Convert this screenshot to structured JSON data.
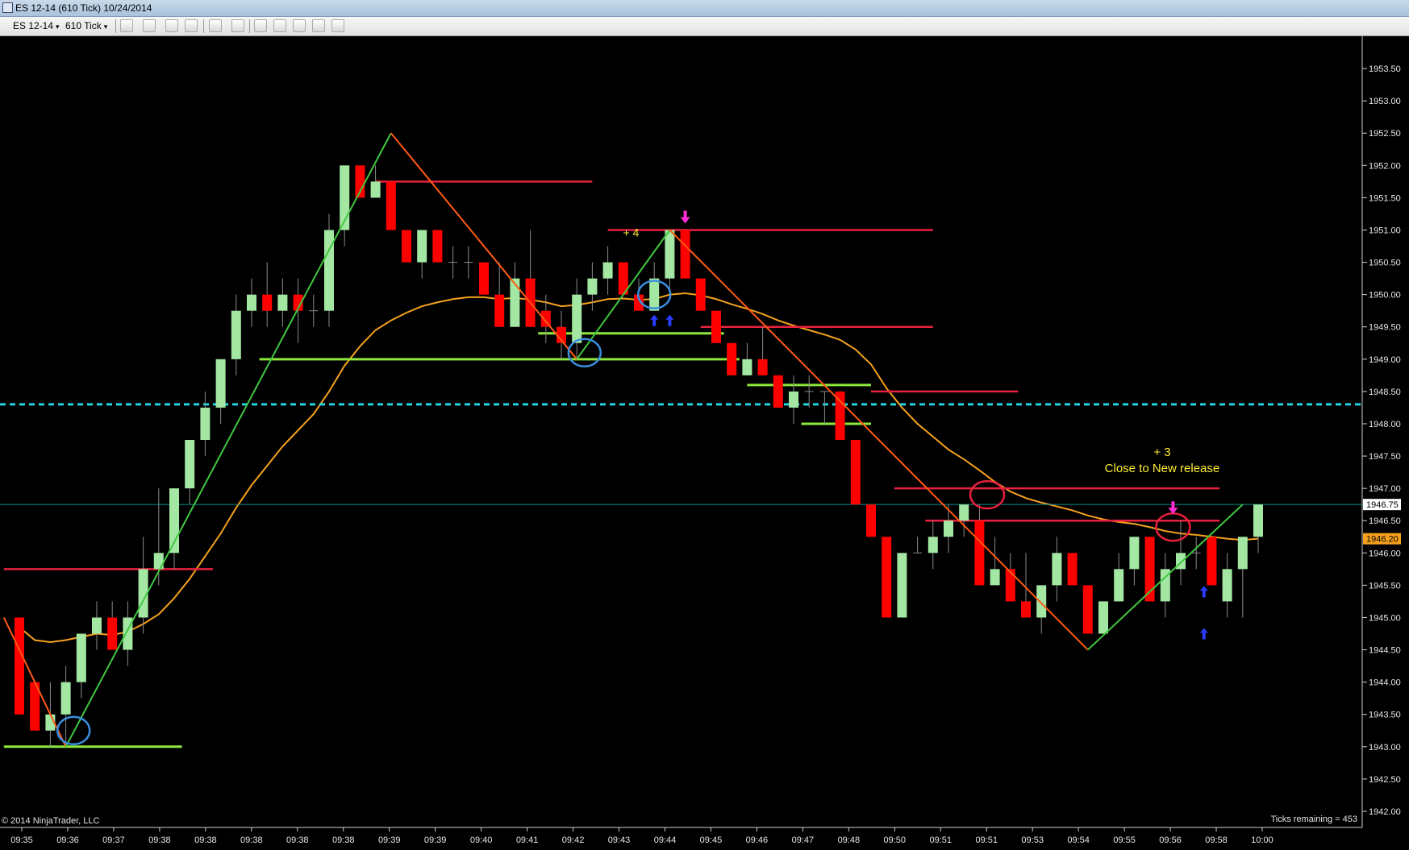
{
  "window": {
    "title": "ES 12-14 (610 Tick)  10/24/2014"
  },
  "toolbar": {
    "instrument": "ES 12-14",
    "interval": "610 Tick",
    "icons": [
      "bar-type-icon",
      "pencil-draw-icon",
      "indicator-icon",
      "strategy-icon",
      "crosshair-icon",
      "zoom-icon",
      "order-entry-icon",
      "data-box-icon",
      "chart-properties-icon",
      "snapshot-icon",
      "print-icon"
    ]
  },
  "colors": {
    "up": "#a3e7a3",
    "down": "#ff0000",
    "wick": "#8a8a8a",
    "ema": "#f5a11e",
    "resistance": "#e8213e",
    "support": "#8ee83c",
    "swing_up": "#40c840",
    "swing_down": "#ff5a14",
    "prior_close": "#22d4e0",
    "last_price_line": "#0a8c8c",
    "annotation": "#ffee33",
    "circle_blue": "#3a8ee0",
    "circle_red": "#e8213e",
    "arrow_magenta": "#ff2ed2",
    "arrow_blue": "#2a3cff"
  },
  "chart_data": {
    "type": "candlestick",
    "instrument": "ES 12-14",
    "interval": "610 Tick",
    "y_ticks": [
      1953.5,
      1953.0,
      1952.5,
      1952.0,
      1951.5,
      1951.0,
      1950.5,
      1950.0,
      1949.5,
      1949.0,
      1948.5,
      1948.0,
      1947.5,
      1947.0,
      1946.5,
      1946.0,
      1945.5,
      1945.0,
      1944.5,
      1944.0,
      1943.5,
      1943.0,
      1942.5,
      1942.0
    ],
    "y_tick_labels": [
      "1953.50",
      "1953.00",
      "1952.50",
      "1952.00",
      "1951.50",
      "1951.00",
      "1950.50",
      "1950.00",
      "1949.50",
      "1949.00",
      "1948.50",
      "1948.00",
      "1947.50",
      "1947.00",
      "1946.50",
      "1946.00",
      "1945.50",
      "1945.00",
      "1944.50",
      "1944.00",
      "1943.50",
      "1943.00",
      "1942.50",
      "1942.00"
    ],
    "ylim": [
      1941.75,
      1954.0
    ],
    "x_tick_labels": [
      "09:35",
      "09:36",
      "09:37",
      "09:38",
      "09:38",
      "09:38",
      "09:38",
      "09:38",
      "09:39",
      "09:39",
      "09:40",
      "09:41",
      "09:42",
      "09:43",
      "09:44",
      "09:45",
      "09:46",
      "09:47",
      "09:48",
      "09:50",
      "09:51",
      "09:51",
      "09:53",
      "09:54",
      "09:55",
      "09:56",
      "09:58",
      "10:00"
    ],
    "candles": [
      {
        "o": 1945.0,
        "h": 1945.0,
        "l": 1943.5,
        "c": 1943.5
      },
      {
        "o": 1944.0,
        "h": 1944.0,
        "l": 1943.25,
        "c": 1943.25
      },
      {
        "o": 1943.25,
        "h": 1944.0,
        "l": 1943.0,
        "c": 1943.5
      },
      {
        "o": 1943.5,
        "h": 1944.25,
        "l": 1943.0,
        "c": 1944.0
      },
      {
        "o": 1944.0,
        "h": 1944.75,
        "l": 1943.75,
        "c": 1944.75
      },
      {
        "o": 1944.75,
        "h": 1945.25,
        "l": 1944.5,
        "c": 1945.0
      },
      {
        "o": 1945.0,
        "h": 1945.25,
        "l": 1944.5,
        "c": 1944.5
      },
      {
        "o": 1944.5,
        "h": 1945.25,
        "l": 1944.25,
        "c": 1945.0
      },
      {
        "o": 1945.0,
        "h": 1946.25,
        "l": 1944.75,
        "c": 1945.75
      },
      {
        "o": 1945.75,
        "h": 1947.0,
        "l": 1945.5,
        "c": 1946.0
      },
      {
        "o": 1946.0,
        "h": 1947.0,
        "l": 1945.75,
        "c": 1947.0
      },
      {
        "o": 1947.0,
        "h": 1947.75,
        "l": 1946.75,
        "c": 1947.75
      },
      {
        "o": 1947.75,
        "h": 1948.5,
        "l": 1947.5,
        "c": 1948.25
      },
      {
        "o": 1948.25,
        "h": 1949.0,
        "l": 1948.0,
        "c": 1949.0
      },
      {
        "o": 1949.0,
        "h": 1950.0,
        "l": 1948.75,
        "c": 1949.75
      },
      {
        "o": 1949.75,
        "h": 1950.25,
        "l": 1949.5,
        "c": 1950.0
      },
      {
        "o": 1950.0,
        "h": 1950.5,
        "l": 1949.5,
        "c": 1949.75
      },
      {
        "o": 1949.75,
        "h": 1950.25,
        "l": 1949.5,
        "c": 1950.0
      },
      {
        "o": 1950.0,
        "h": 1950.25,
        "l": 1949.25,
        "c": 1949.75
      },
      {
        "o": 1949.75,
        "h": 1950.0,
        "l": 1949.5,
        "c": 1949.75
      },
      {
        "o": 1949.75,
        "h": 1951.25,
        "l": 1949.5,
        "c": 1951.0
      },
      {
        "o": 1951.0,
        "h": 1952.0,
        "l": 1950.75,
        "c": 1952.0
      },
      {
        "o": 1952.0,
        "h": 1952.0,
        "l": 1951.5,
        "c": 1951.5
      },
      {
        "o": 1951.5,
        "h": 1952.0,
        "l": 1951.5,
        "c": 1951.75
      },
      {
        "o": 1951.75,
        "h": 1951.75,
        "l": 1951.0,
        "c": 1951.0
      },
      {
        "o": 1951.0,
        "h": 1951.0,
        "l": 1950.5,
        "c": 1950.5
      },
      {
        "o": 1950.5,
        "h": 1951.0,
        "l": 1950.25,
        "c": 1951.0
      },
      {
        "o": 1951.0,
        "h": 1951.0,
        "l": 1950.5,
        "c": 1950.5
      },
      {
        "o": 1950.5,
        "h": 1950.75,
        "l": 1950.25,
        "c": 1950.5
      },
      {
        "o": 1950.5,
        "h": 1950.75,
        "l": 1950.25,
        "c": 1950.5
      },
      {
        "o": 1950.5,
        "h": 1950.5,
        "l": 1950.0,
        "c": 1950.0
      },
      {
        "o": 1950.0,
        "h": 1950.5,
        "l": 1949.5,
        "c": 1949.5
      },
      {
        "o": 1949.5,
        "h": 1950.5,
        "l": 1949.5,
        "c": 1950.25
      },
      {
        "o": 1950.25,
        "h": 1951.0,
        "l": 1949.5,
        "c": 1949.5
      },
      {
        "o": 1949.75,
        "h": 1950.0,
        "l": 1949.25,
        "c": 1949.5
      },
      {
        "o": 1949.5,
        "h": 1949.75,
        "l": 1949.0,
        "c": 1949.25
      },
      {
        "o": 1949.25,
        "h": 1950.25,
        "l": 1949.0,
        "c": 1950.0
      },
      {
        "o": 1950.0,
        "h": 1950.5,
        "l": 1949.75,
        "c": 1950.25
      },
      {
        "o": 1950.25,
        "h": 1950.75,
        "l": 1950.0,
        "c": 1950.5
      },
      {
        "o": 1950.5,
        "h": 1950.5,
        "l": 1950.0,
        "c": 1950.0
      },
      {
        "o": 1950.0,
        "h": 1950.25,
        "l": 1949.75,
        "c": 1949.75
      },
      {
        "o": 1949.75,
        "h": 1950.5,
        "l": 1949.75,
        "c": 1950.25
      },
      {
        "o": 1950.25,
        "h": 1951.0,
        "l": 1950.0,
        "c": 1951.0
      },
      {
        "o": 1951.0,
        "h": 1951.0,
        "l": 1950.25,
        "c": 1950.25
      },
      {
        "o": 1950.25,
        "h": 1950.25,
        "l": 1949.75,
        "c": 1949.75
      },
      {
        "o": 1949.75,
        "h": 1949.75,
        "l": 1949.25,
        "c": 1949.25
      },
      {
        "o": 1949.25,
        "h": 1949.25,
        "l": 1948.75,
        "c": 1948.75
      },
      {
        "o": 1948.75,
        "h": 1949.25,
        "l": 1948.75,
        "c": 1949.0
      },
      {
        "o": 1949.0,
        "h": 1949.5,
        "l": 1948.75,
        "c": 1948.75
      },
      {
        "o": 1948.75,
        "h": 1948.75,
        "l": 1948.25,
        "c": 1948.25
      },
      {
        "o": 1948.25,
        "h": 1948.75,
        "l": 1948.0,
        "c": 1948.5
      },
      {
        "o": 1948.5,
        "h": 1948.75,
        "l": 1948.25,
        "c": 1948.5
      },
      {
        "o": 1948.5,
        "h": 1948.5,
        "l": 1948.0,
        "c": 1948.5
      },
      {
        "o": 1948.5,
        "h": 1948.5,
        "l": 1947.75,
        "c": 1947.75
      },
      {
        "o": 1947.75,
        "h": 1947.75,
        "l": 1946.75,
        "c": 1946.75
      },
      {
        "o": 1946.75,
        "h": 1946.75,
        "l": 1946.25,
        "c": 1946.25
      },
      {
        "o": 1946.25,
        "h": 1946.25,
        "l": 1945.0,
        "c": 1945.0
      },
      {
        "o": 1945.0,
        "h": 1946.0,
        "l": 1945.0,
        "c": 1946.0
      },
      {
        "o": 1946.0,
        "h": 1946.25,
        "l": 1946.0,
        "c": 1946.0
      },
      {
        "o": 1946.0,
        "h": 1946.5,
        "l": 1945.75,
        "c": 1946.25
      },
      {
        "o": 1946.25,
        "h": 1946.75,
        "l": 1946.0,
        "c": 1946.5
      },
      {
        "o": 1946.5,
        "h": 1946.75,
        "l": 1946.25,
        "c": 1946.75
      },
      {
        "o": 1946.5,
        "h": 1946.75,
        "l": 1945.5,
        "c": 1945.5
      },
      {
        "o": 1945.5,
        "h": 1946.25,
        "l": 1945.5,
        "c": 1945.75
      },
      {
        "o": 1945.75,
        "h": 1946.0,
        "l": 1945.25,
        "c": 1945.25
      },
      {
        "o": 1945.25,
        "h": 1946.0,
        "l": 1945.0,
        "c": 1945.0
      },
      {
        "o": 1945.0,
        "h": 1945.5,
        "l": 1944.75,
        "c": 1945.5
      },
      {
        "o": 1945.5,
        "h": 1946.25,
        "l": 1945.25,
        "c": 1946.0
      },
      {
        "o": 1946.0,
        "h": 1946.0,
        "l": 1945.5,
        "c": 1945.5
      },
      {
        "o": 1945.5,
        "h": 1945.5,
        "l": 1944.75,
        "c": 1944.75
      },
      {
        "o": 1944.75,
        "h": 1945.25,
        "l": 1944.75,
        "c": 1945.25
      },
      {
        "o": 1945.25,
        "h": 1946.0,
        "l": 1945.25,
        "c": 1945.75
      },
      {
        "o": 1945.75,
        "h": 1946.25,
        "l": 1945.5,
        "c": 1946.25
      },
      {
        "o": 1946.25,
        "h": 1946.25,
        "l": 1945.25,
        "c": 1945.25
      },
      {
        "o": 1945.25,
        "h": 1946.0,
        "l": 1945.0,
        "c": 1945.75
      },
      {
        "o": 1945.75,
        "h": 1946.5,
        "l": 1945.5,
        "c": 1946.0
      },
      {
        "o": 1946.0,
        "h": 1946.25,
        "l": 1945.75,
        "c": 1946.0
      },
      {
        "o": 1946.25,
        "h": 1946.25,
        "l": 1945.5,
        "c": 1945.5
      },
      {
        "o": 1945.25,
        "h": 1946.0,
        "l": 1945.0,
        "c": 1945.75
      },
      {
        "o": 1945.75,
        "h": 1946.25,
        "l": 1945.0,
        "c": 1946.25
      },
      {
        "o": 1946.25,
        "h": 1946.75,
        "l": 1946.0,
        "c": 1946.75
      }
    ],
    "ema": [
      1944.85,
      1944.65,
      1944.62,
      1944.65,
      1944.7,
      1944.75,
      1944.73,
      1944.78,
      1944.9,
      1945.05,
      1945.3,
      1945.6,
      1945.95,
      1946.3,
      1946.7,
      1947.05,
      1947.35,
      1947.65,
      1947.9,
      1948.15,
      1948.5,
      1948.9,
      1949.2,
      1949.45,
      1949.6,
      1949.72,
      1949.82,
      1949.88,
      1949.93,
      1949.96,
      1949.96,
      1949.93,
      1949.95,
      1949.92,
      1949.88,
      1949.82,
      1949.84,
      1949.88,
      1949.93,
      1949.94,
      1949.92,
      1949.93,
      1950.0,
      1950.02,
      1949.99,
      1949.93,
      1949.85,
      1949.78,
      1949.7,
      1949.6,
      1949.52,
      1949.45,
      1949.38,
      1949.3,
      1949.15,
      1948.92,
      1948.55,
      1948.25,
      1948.0,
      1947.8,
      1947.6,
      1947.45,
      1947.28,
      1947.1,
      1946.95,
      1946.85,
      1946.78,
      1946.72,
      1946.66,
      1946.58,
      1946.52,
      1946.48,
      1946.45,
      1946.4,
      1946.34,
      1946.3,
      1946.28,
      1946.25,
      1946.22,
      1946.2,
      1946.22
    ],
    "swing_lines": [
      {
        "kind": "down",
        "points": [
          [
            -1,
            1945.0
          ],
          [
            3,
            1943.0
          ]
        ]
      },
      {
        "kind": "up",
        "points": [
          [
            3,
            1943.0
          ],
          [
            24,
            1952.5
          ]
        ]
      },
      {
        "kind": "down",
        "points": [
          [
            24,
            1952.5
          ],
          [
            36,
            1949.0
          ]
        ]
      },
      {
        "kind": "up",
        "points": [
          [
            36,
            1949.0
          ],
          [
            42,
            1951.0
          ]
        ]
      },
      {
        "kind": "down",
        "points": [
          [
            42,
            1951.0
          ],
          [
            69,
            1944.5
          ]
        ]
      },
      {
        "kind": "up",
        "points": [
          [
            69,
            1944.5
          ],
          [
            79,
            1946.75
          ]
        ]
      }
    ],
    "resistance_lines": [
      {
        "from": -1,
        "to": 12.5,
        "y": 1945.75
      },
      {
        "from": 23,
        "to": 37,
        "y": 1951.75
      },
      {
        "from": 38,
        "to": 59,
        "y": 1951.0
      },
      {
        "from": 44,
        "to": 59,
        "y": 1949.5
      },
      {
        "from": 55,
        "to": 64.5,
        "y": 1948.5
      },
      {
        "from": 56.5,
        "to": 77.5,
        "y": 1947.0
      },
      {
        "from": 58.5,
        "to": 77.5,
        "y": 1946.5
      }
    ],
    "support_lines": [
      {
        "from": -1,
        "to": 10.5,
        "y": 1943.0
      },
      {
        "from": 15.5,
        "to": 46.5,
        "y": 1949.0
      },
      {
        "from": 33.5,
        "to": 45.5,
        "y": 1949.4
      },
      {
        "from": 47,
        "to": 55,
        "y": 1948.6
      },
      {
        "from": 50.5,
        "to": 55,
        "y": 1948.0
      }
    ],
    "prior_close_level": 1948.3,
    "last_price": 1946.75,
    "last_price_label": "1946.75",
    "ema_label": "1946.20",
    "annotations": [
      {
        "text": "+ 4",
        "x": 39.5,
        "y": 1950.9
      },
      {
        "text": "+ 3",
        "x": 73.8,
        "y": 1947.5
      },
      {
        "text": "Close to New release",
        "x": 73.8,
        "y": 1947.25
      }
    ],
    "blue_circles": [
      [
        3.5,
        1943.25
      ],
      [
        36.5,
        1949.1
      ],
      [
        41,
        1950.0
      ]
    ],
    "red_circles": [
      [
        62.5,
        1946.9
      ],
      [
        74.5,
        1946.4
      ]
    ],
    "magenta_arrows": [
      [
        43,
        1951.1
      ],
      [
        74.5,
        1946.6
      ]
    ],
    "blue_arrows": [
      [
        41,
        1949.6
      ],
      [
        42,
        1949.6
      ],
      [
        76.5,
        1944.75
      ],
      [
        76.5,
        1945.4
      ]
    ],
    "footer_left": "© 2014 NinjaTrader, LLC",
    "footer_right": "Ticks remaining = 453"
  }
}
